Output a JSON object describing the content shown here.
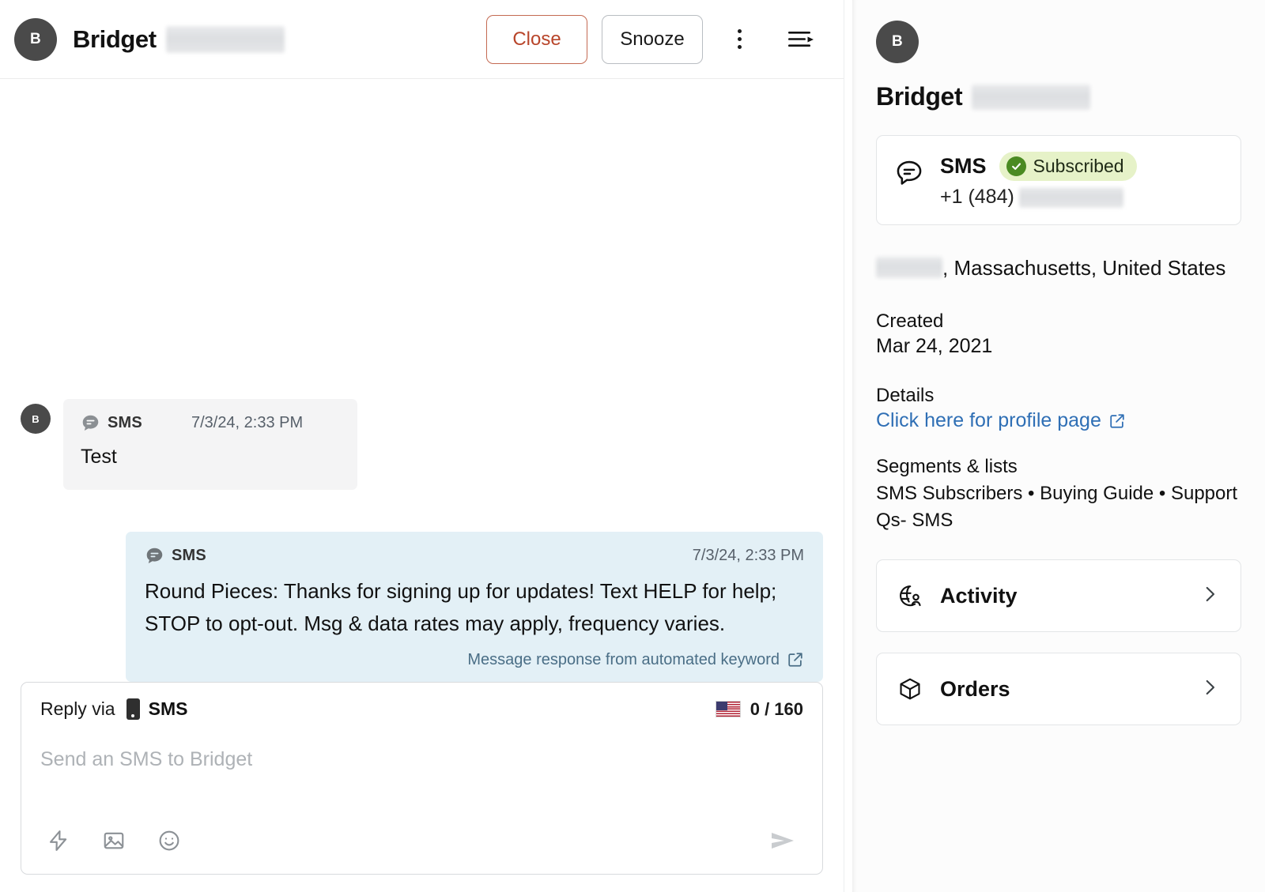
{
  "conversation": {
    "header": {
      "avatar_initial": "B",
      "contact_name": "Bridget",
      "close_label": "Close",
      "snooze_label": "Snooze",
      "more_icon": "kebab-menu-icon",
      "collapse_icon": "collapse-panel-icon"
    },
    "messages": [
      {
        "direction": "inbound",
        "avatar_initial": "B",
        "channel": "SMS",
        "channel_icon": "sms-bubble-icon",
        "timestamp": "7/3/24, 2:33 PM",
        "body": "Test"
      },
      {
        "direction": "outbound",
        "channel": "SMS",
        "channel_icon": "sms-bubble-icon",
        "timestamp": "7/3/24, 2:33 PM",
        "body": "Round Pieces: Thanks for signing up for updates! Text HELP for help; STOP to opt-out. Msg & data rates may apply, frequency varies.",
        "footer_link": "Message response from automated keyword",
        "footer_icon": "external-link-icon"
      }
    ],
    "composer": {
      "reply_via_label": "Reply via",
      "channel": "SMS",
      "channel_icon": "mobile-phone-icon",
      "flag": "🇺🇸",
      "counter": "0 / 160",
      "placeholder": "Send an SMS to Bridget",
      "tools": [
        {
          "name": "quick-reply-icon"
        },
        {
          "name": "image-attachment-icon"
        },
        {
          "name": "emoji-picker-icon"
        }
      ],
      "send_icon": "send-icon"
    }
  },
  "profile": {
    "avatar_initial": "B",
    "name": "Bridget",
    "sms_card": {
      "icon": "sms-bubble-outline-icon",
      "title": "SMS",
      "badge_label": "Subscribed",
      "badge_icon": "check-circle-icon",
      "phone_prefix": "+1 (484)"
    },
    "location": ", Massachusetts, United States",
    "created_label": "Created",
    "created_value": "Mar 24, 2021",
    "details_label": "Details",
    "details_link": "Click here for profile page",
    "details_link_icon": "external-link-icon",
    "segments_label": "Segments & lists",
    "segments_value": "SMS Subscribers • Buying Guide • Support Qs- SMS",
    "nav_items": [
      {
        "label": "Activity",
        "icon": "activity-globe-icon",
        "chevron": "chevron-right-icon"
      },
      {
        "label": "Orders",
        "icon": "package-box-icon",
        "chevron": "chevron-right-icon"
      }
    ]
  },
  "colors": {
    "close_red": "#b8452a",
    "outbound_bubble": "#e3f0f6",
    "inbound_bubble": "#f4f4f5",
    "badge_green_bg": "#e6f2c8",
    "badge_green_fg": "#4a8a22",
    "link_blue": "#2f6fb5"
  }
}
